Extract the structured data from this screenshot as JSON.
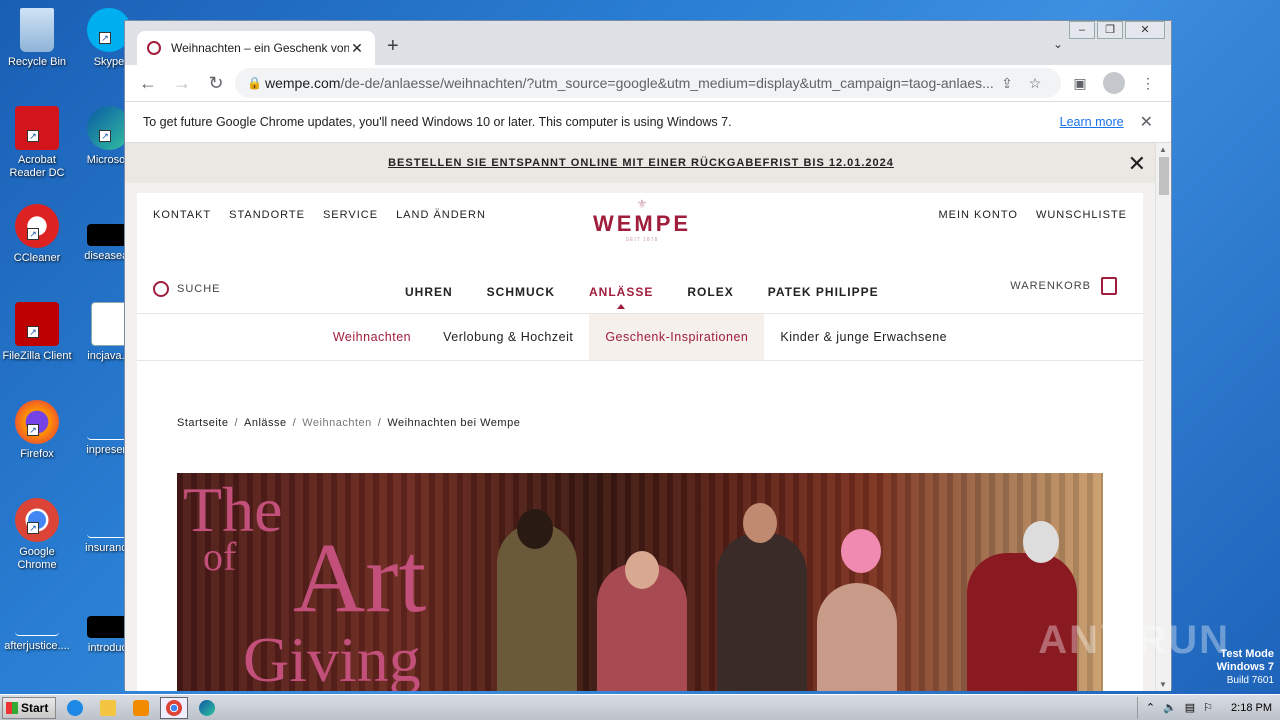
{
  "desktop": {
    "icons": [
      {
        "label": "Recycle Bin"
      },
      {
        "label": "Skype"
      },
      {
        "label": "Acrobat Reader DC"
      },
      {
        "label": "Microsoft"
      },
      {
        "label": "CCleaner"
      },
      {
        "label": "diseaseas"
      },
      {
        "label": "FileZilla Client"
      },
      {
        "label": "incjava..."
      },
      {
        "label": "Firefox"
      },
      {
        "label": "inpresent"
      },
      {
        "label": "Google Chrome"
      },
      {
        "label": "insurance"
      },
      {
        "label": "afterjustice...."
      },
      {
        "label": "introduct"
      }
    ]
  },
  "browser": {
    "tab_title": "Weihnachten – ein Geschenk von We",
    "url_host": "wempe.com",
    "url_path": "/de-de/anlaesse/weihnachten/?utm_source=google&utm_medium=display&utm_campaign=taog-anlaes...",
    "infobar_message": "To get future Google Chrome updates, you'll need Windows 10 or later. This computer is using Windows 7.",
    "infobar_link": "Learn more"
  },
  "site": {
    "promo": "BESTELLEN SIE ENTSPANNT ONLINE MIT EINER RÜCKGABEFRIST BIS 12.01.2024",
    "top_left": [
      "KONTAKT",
      "STANDORTE",
      "SERVICE",
      "LAND ÄNDERN"
    ],
    "top_right": [
      "MEIN KONTO",
      "WUNSCHLISTE"
    ],
    "logo": "WEMPE",
    "logo_sub": "SEIT 1878",
    "search_label": "SUCHE",
    "main_nav": [
      "UHREN",
      "SCHMUCK",
      "ANLÄSSE",
      "ROLEX",
      "PATEK PHILIPPE"
    ],
    "cart_label": "WARENKORB",
    "sub_nav": [
      "Weihnachten",
      "Verlobung & Hochzeit",
      "Geschenk-Inspirationen",
      "Kinder & junge Erwachsene"
    ],
    "breadcrumb": [
      "Startseite",
      "Anlässe",
      "Weihnachten",
      "Weihnachten bei Wempe"
    ],
    "hero_text": [
      "The",
      "of",
      "Art",
      "Giving"
    ]
  },
  "os": {
    "watermark": "ANY.RUN",
    "test_mode": "Test Mode",
    "os_name": "Windows 7",
    "build": "Build 7601",
    "start_label": "Start",
    "clock": "2:18 PM"
  },
  "colors": {
    "brand": "#a01e3c",
    "desktop_blue": "#1a5fb4"
  }
}
